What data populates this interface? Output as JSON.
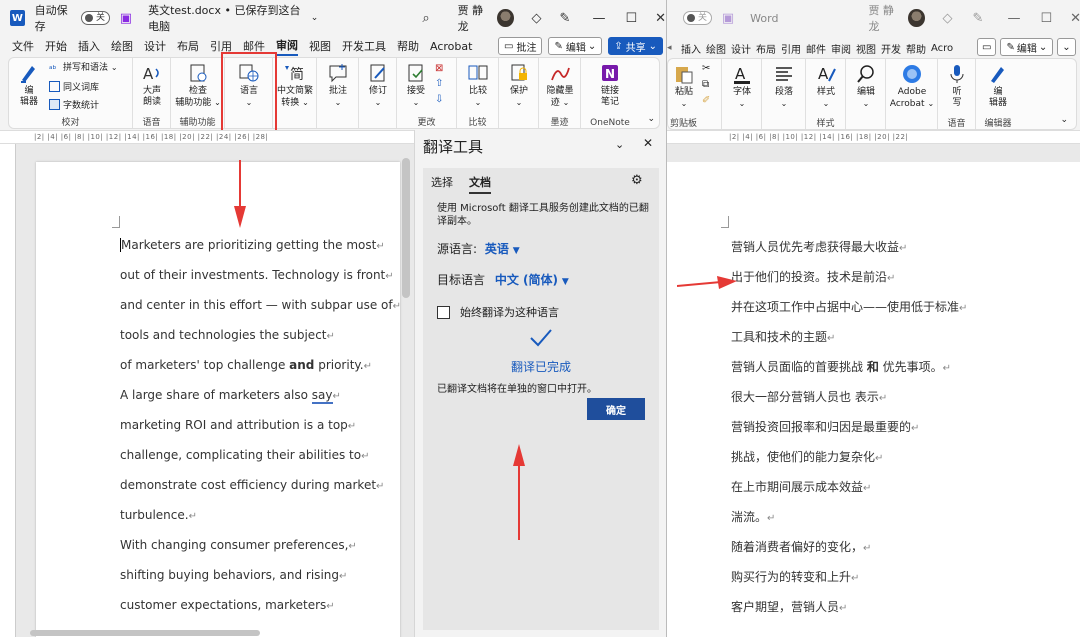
{
  "left_window": {
    "title_bar": {
      "app_letter": "W",
      "autosave_label": "自动保存",
      "autosave_state": "关",
      "doc_title": "英文test.docx • 已保存到这台电脑",
      "user_name": "贾 静龙"
    },
    "menu": [
      "文件",
      "开始",
      "插入",
      "绘图",
      "设计",
      "布局",
      "引用",
      "邮件",
      "审阅",
      "视图",
      "开发工具",
      "帮助",
      "Acrobat"
    ],
    "menu_active": "审阅",
    "actions": {
      "comments": "批注",
      "edit": "编辑",
      "share": "共享"
    },
    "ribbon": {
      "spelling": "拼写和语法",
      "thesaurus": "同义词库",
      "word_count": "字数统计",
      "editor": [
        "编",
        "辑器"
      ],
      "group_proofing": "校对",
      "read_aloud": [
        "大声",
        "朗读"
      ],
      "group_speech": "语音",
      "check_accessibility": [
        "检查",
        "辅助功能"
      ],
      "group_accessibility": "辅助功能",
      "language": "语言",
      "chinese_conversion": [
        "中文简繁",
        "转换"
      ],
      "comment": "批注",
      "track_changes": "修订",
      "accept": "接受",
      "group_changes": "更改",
      "compare": "比较",
      "group_compare": "比较",
      "protect": "保护",
      "hide_ink": [
        "隐藏墨",
        "迹"
      ],
      "group_ink": "墨迹",
      "linked_notes": [
        "链接",
        "笔记"
      ],
      "group_onenote": "OneNote"
    },
    "ruler_text": "|2|  |4|  |6|  |8|  |10|  |12|  |14|  |16|  |18|  |20|  |22|  |24|  |26|  |28|",
    "doc_lines": [
      "Marketers are prioritizing getting the most",
      "out of their investments. Technology is front",
      "and center in this effort — with subpar use of",
      "tools and technologies the subject",
      "of marketers' top challenge ",
      "A large share of marketers also ",
      "marketing ROI and attribution is a top",
      "challenge, complicating their abilities to",
      "demonstrate cost efficiency during market",
      "turbulence.",
      "With changing consumer preferences,",
      "shifting buying behaviors, and rising",
      "customer expectations, marketers"
    ],
    "doc_bold_and": "and",
    "doc_priority": " priority.",
    "doc_say": "say",
    "para_mark": "↵"
  },
  "translator": {
    "title": "翻译工具",
    "tabs": [
      "选择",
      "文档"
    ],
    "active_tab": "文档",
    "description": "使用 Microsoft 翻译工具服务创建此文档的已翻译副本。",
    "source_label": "源语言:",
    "source_value": "英语",
    "target_label": "目标语言",
    "target_value": "中文 (简体)",
    "always_translate": "始终翻译为这种语言",
    "status": "翻译已完成",
    "status_detail": "已翻译文档将在单独的窗口中打开。",
    "ok_button": "确定"
  },
  "right_window": {
    "title_bar": {
      "autosave_state": "关",
      "app_name": "Word",
      "user_name": "贾 静龙"
    },
    "menu": [
      "插入",
      "绘图",
      "设计",
      "布局",
      "引用",
      "邮件",
      "审阅",
      "视图",
      "开发",
      "帮助",
      "Acro"
    ],
    "edit_label": "编辑",
    "ribbon": {
      "paste": "粘贴",
      "group_clipboard": "剪贴板",
      "font": "字体",
      "paragraph": "段落",
      "styles": "样式",
      "group_styles": "样式",
      "editing": "编辑",
      "adobe": [
        "Adobe",
        "Acrobat"
      ],
      "dictate": [
        "听",
        "写"
      ],
      "group_voice": "语音",
      "editor": [
        "编",
        "辑器"
      ],
      "group_editor": "编辑器"
    },
    "ruler_text": "|2|  |4|  |6|  |8|  |10|  |12|  |14|  |16|  |18|  |20|  |22|",
    "doc_lines": [
      "营销人员优先考虑获得最大收益",
      "出于他们的投资。技术是前沿",
      "并在这项工作中占据中心——使用低于标准",
      "工具和技术的主题",
      "营销人员面临的首要挑战 ",
      "很大一部分营销人员也 表示",
      "营销投资回报率和归因是最重要的",
      "挑战，使他们的能力复杂化",
      "在上市期间展示成本效益",
      "湍流。",
      "随着消费者偏好的变化，",
      "购买行为的转变和上升",
      "客户期望，营销人员"
    ],
    "bold_and": "和",
    "priority_tail": " 优先事项。"
  },
  "colors": {
    "accent": "#185abd",
    "annotation_red": "#e53935"
  }
}
